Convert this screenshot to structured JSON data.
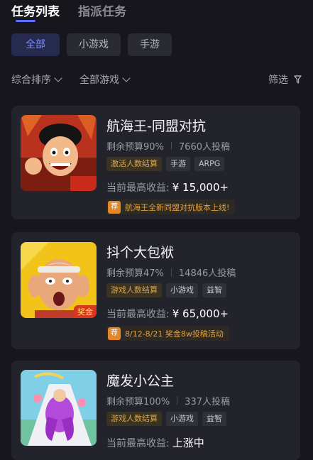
{
  "tabs": [
    {
      "label": "任务列表",
      "active": true
    },
    {
      "label": "指派任务",
      "active": false
    }
  ],
  "chips": [
    {
      "label": "全部",
      "active": true
    },
    {
      "label": "小游戏",
      "active": false
    },
    {
      "label": "手游",
      "active": false
    }
  ],
  "filters": {
    "sort_label": "综合排序",
    "game_label": "全部游戏",
    "screen_label": "筛选"
  },
  "tasks": [
    {
      "title": "航海王-同盟对抗",
      "budget": "剩余预算90%",
      "submissions": "7660人投稿",
      "tags": [
        "激活人数结算",
        "手游",
        "ARPG"
      ],
      "income_label": "当前最高收益:",
      "income_value": "¥ 15,000+",
      "promo_badge": "荐",
      "promo_text": "航海王全新同盟对抗版本上线!",
      "thumb_icon": "pirate-character-icon"
    },
    {
      "title": "抖个大包袱",
      "budget": "剩余预算47%",
      "submissions": "14846人投稿",
      "tags": [
        "游戏人数结算",
        "小游戏",
        "益智"
      ],
      "income_label": "当前最高收益:",
      "income_value": "¥ 65,000+",
      "promo_badge": "荐",
      "promo_text": "8/12-8/21 奖金8w投稿活动",
      "thumb_badge": "奖金",
      "thumb_icon": "shocked-man-icon"
    },
    {
      "title": "魔发小公主",
      "budget": "剩余预算100%",
      "submissions": "337人投稿",
      "tags": [
        "游戏人数结算",
        "小游戏",
        "益智"
      ],
      "income_label": "当前最高收益:",
      "income_value": "上涨中",
      "thumb_icon": "hair-runner-icon"
    }
  ],
  "colors": {
    "background": "#16161c",
    "card": "#23232b",
    "accent": "#7f8cff",
    "gold": "#d9a54a"
  }
}
